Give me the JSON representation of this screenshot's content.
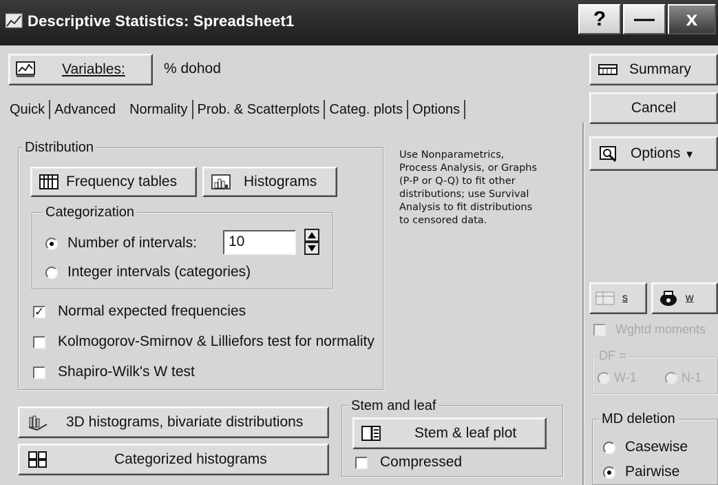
{
  "window": {
    "title": "Descriptive Statistics: Spreadsheet1",
    "help_label": "?",
    "minimize_label": "—",
    "close_label": "x"
  },
  "variables": {
    "button_label": "Variables:",
    "value": "% dohod"
  },
  "tabs": [
    "Quick",
    "Advanced",
    "Normality",
    "Prob. & Scatterplots",
    "Categ. plots",
    "Options"
  ],
  "active_tab": "Normality",
  "distribution": {
    "title": "Distribution",
    "frequency_tables": "Frequency tables",
    "histograms": "Histograms"
  },
  "categorization": {
    "title": "Categorization",
    "number_of_intervals_label": "Number of intervals:",
    "number_of_intervals_value": "10",
    "integer_intervals_label": "Integer intervals (categories)",
    "selected": "number_of_intervals"
  },
  "tests": {
    "normal_expected": {
      "label": "Normal expected frequencies",
      "checked": true
    },
    "ks_lilliefors": {
      "label": "Kolmogorov-Smirnov & Lilliefors test for normality",
      "checked": false
    },
    "shapiro_wilk": {
      "label": "Shapiro-Wilk's W test",
      "checked": false
    }
  },
  "note_lines": [
    "Use Nonparametrics,",
    "Process Analysis, or Graphs",
    "(P-P or Q-Q) to fit other",
    "distributions; use Survival",
    "Analysis to fit distributions",
    "to censored data."
  ],
  "bottom": {
    "histograms_3d": "3D histograms, bivariate distributions",
    "categorized_histograms": "Categorized histograms"
  },
  "stem_leaf": {
    "title": "Stem and leaf",
    "plot_button": "Stem & leaf plot",
    "compressed_label": "Compressed",
    "compressed_checked": false
  },
  "right_panel": {
    "summary": "Summary",
    "cancel": "Cancel",
    "options": "Options",
    "s_button": "s",
    "w_button": "w",
    "wghtd_moments": "Wghtd moments",
    "df_title": "DF =",
    "df_w1": "W-1",
    "df_n1": "N-1",
    "md_deletion": {
      "title": "MD deletion",
      "casewise": "Casewise",
      "pairwise": "Pairwise",
      "selected": "pairwise"
    }
  },
  "colors": {
    "background": "#d6d6d6",
    "titlebar": "#2a2a2a"
  }
}
